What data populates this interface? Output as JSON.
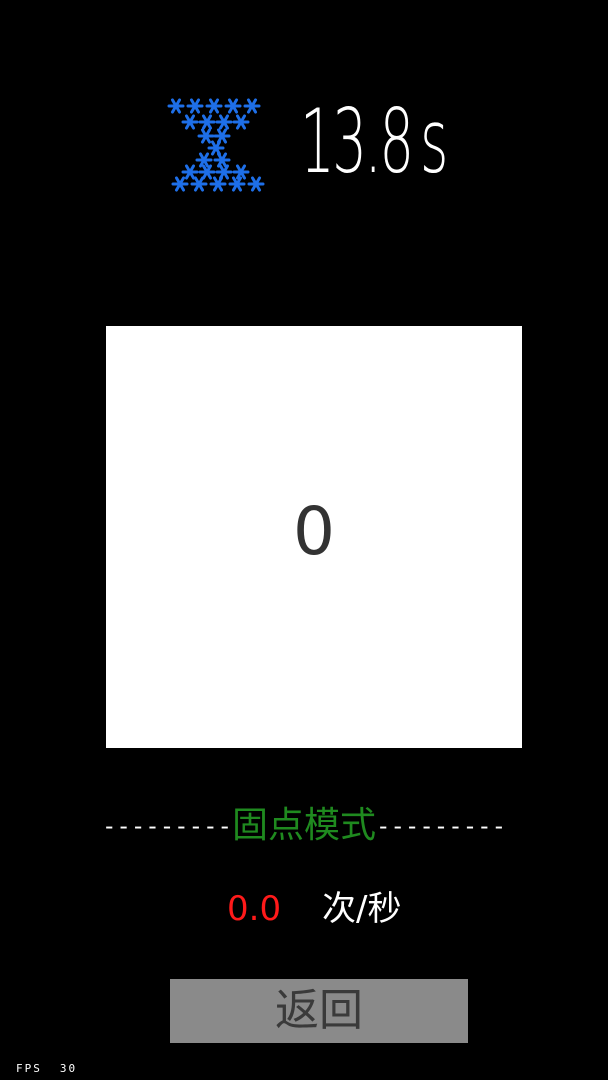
{
  "timer": {
    "icon": "hourglass-icon",
    "icon_color": "#1e6fe8",
    "value": "13.8",
    "unit": "s"
  },
  "tap_area": {
    "count": "0"
  },
  "mode": {
    "dashes_left": "---------",
    "label": "固点模式",
    "dashes_right": "---------",
    "label_color": "#1f8a1f"
  },
  "rate": {
    "value": "0.0",
    "value_color": "#ff1a1a",
    "unit": "次/秒"
  },
  "back_button": {
    "label": "返回"
  },
  "fps": {
    "label": "FPS",
    "value": "30"
  }
}
